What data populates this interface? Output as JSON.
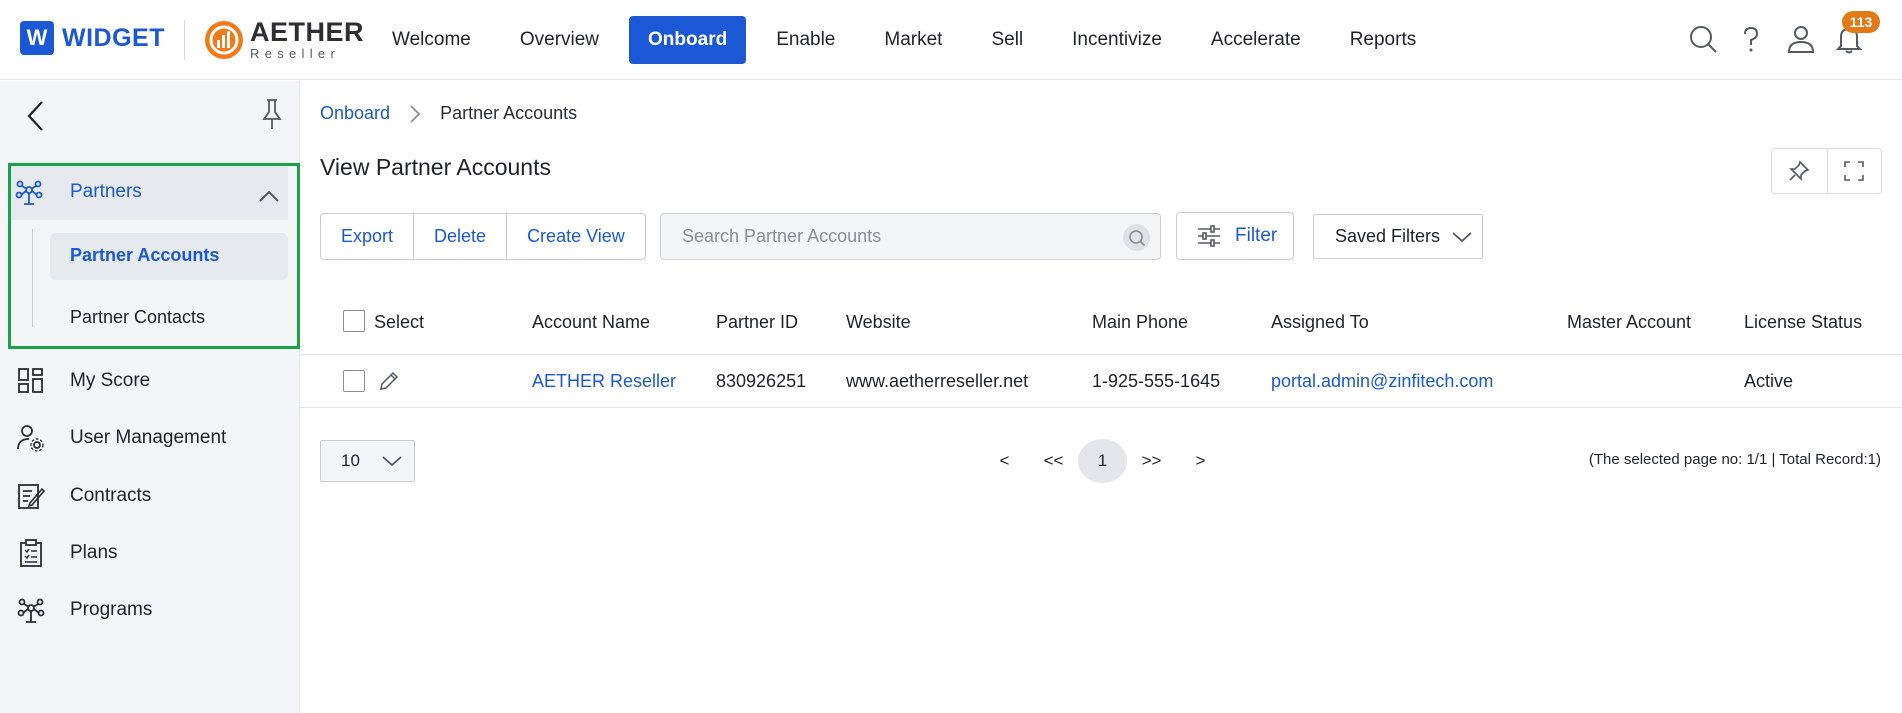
{
  "brand": {
    "badge_letter": "W",
    "name": "WIDGET"
  },
  "reseller_logo": {
    "name": "AETHER",
    "sub": "Reseller"
  },
  "nav": {
    "items": [
      {
        "label": "Welcome"
      },
      {
        "label": "Overview"
      },
      {
        "label": "Onboard",
        "active": true
      },
      {
        "label": "Enable"
      },
      {
        "label": "Market"
      },
      {
        "label": "Sell"
      },
      {
        "label": "Incentivize"
      },
      {
        "label": "Accelerate"
      },
      {
        "label": "Reports"
      }
    ]
  },
  "top_icons": {
    "notification_count": "113"
  },
  "sidebar": {
    "partners": {
      "label": "Partners",
      "children": [
        {
          "label": "Partner Accounts",
          "active": true
        },
        {
          "label": "Partner Contacts"
        }
      ]
    },
    "items": [
      {
        "label": "My Score",
        "icon": "score-icon"
      },
      {
        "label": "User Management",
        "icon": "user-gear-icon"
      },
      {
        "label": "Contracts",
        "icon": "contract-icon"
      },
      {
        "label": "Plans",
        "icon": "clipboard-icon"
      },
      {
        "label": "Programs",
        "icon": "programs-icon"
      }
    ]
  },
  "breadcrumb": {
    "parent": "Onboard",
    "current": "Partner Accounts"
  },
  "page": {
    "title": "View Partner Accounts"
  },
  "toolbar": {
    "export_label": "Export",
    "delete_label": "Delete",
    "create_view_label": "Create View",
    "search_placeholder": "Search Partner Accounts",
    "filter_label": "Filter",
    "saved_filters_label": "Saved Filters"
  },
  "table": {
    "columns": [
      "Select",
      "Account Name",
      "Partner ID",
      "Website",
      "Main Phone",
      "Assigned To",
      "Master Account",
      "License Status"
    ],
    "rows": [
      {
        "account_name": "AETHER Reseller",
        "partner_id": "830926251",
        "website": "www.aetherreseller.net",
        "main_phone": "1-925-555-1645",
        "assigned_to": "portal.admin@zinfitech.com",
        "master_account": "",
        "license_status": "Active"
      }
    ]
  },
  "pagination": {
    "page_size": "10",
    "prev": "<",
    "first": "<<",
    "current_page": "1",
    "last": ">>",
    "next": ">",
    "info": "(The selected page no: 1/1 | Total Record:1)"
  },
  "colors": {
    "primary": "#1a58d6",
    "badge": "#e07b16",
    "highlight_border": "#16a34a"
  }
}
